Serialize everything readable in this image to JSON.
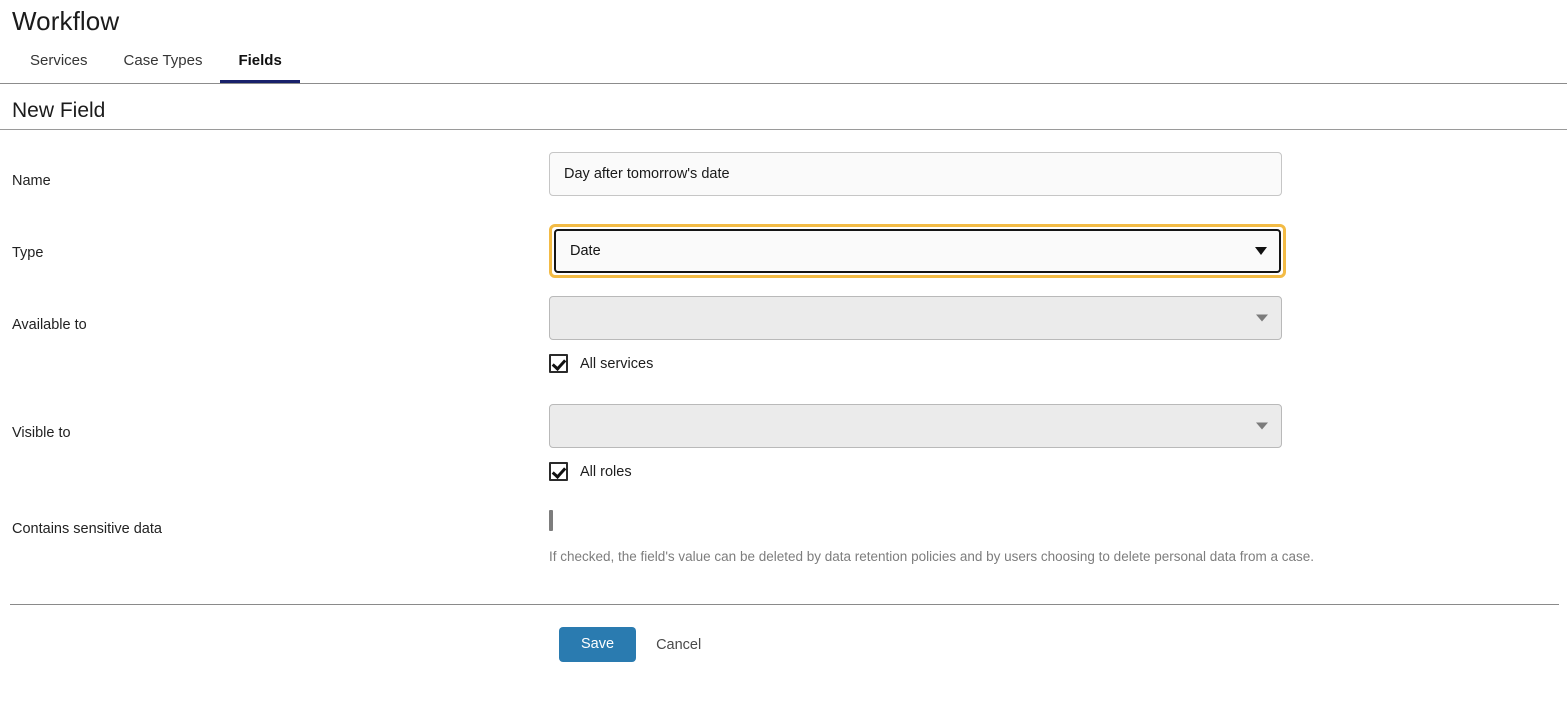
{
  "header": {
    "title": "Workflow",
    "tabs": [
      {
        "label": "Services",
        "active": false
      },
      {
        "label": "Case Types",
        "active": false
      },
      {
        "label": "Fields",
        "active": true
      }
    ]
  },
  "section": {
    "heading": "New Field"
  },
  "form": {
    "name": {
      "label": "Name",
      "value": "Day after tomorrow's date",
      "placeholder": ""
    },
    "type": {
      "label": "Type",
      "value": "Date",
      "focused": true,
      "caret_icon": "chevron-down-icon"
    },
    "available_to": {
      "label": "Available to",
      "value": "",
      "disabled": true,
      "caret_icon": "chevron-down-icon",
      "checkbox": {
        "label": "All services",
        "checked": true
      }
    },
    "visible_to": {
      "label": "Visible to",
      "value": "",
      "disabled": true,
      "caret_icon": "chevron-down-icon",
      "checkbox": {
        "label": "All roles",
        "checked": true
      }
    },
    "sensitive": {
      "label": "Contains sensitive data",
      "checked": false,
      "help": "If checked, the field's value can be deleted by data retention policies and by users choosing to delete personal data from a case."
    }
  },
  "footer": {
    "save_label": "Save",
    "cancel_label": "Cancel"
  },
  "colors": {
    "accent_blue": "#2a7bb0",
    "tab_underline": "#18216b",
    "focus_ring": "#f3bb45",
    "disabled_bg": "#ebebeb",
    "help_text": "#7d7d7d"
  }
}
